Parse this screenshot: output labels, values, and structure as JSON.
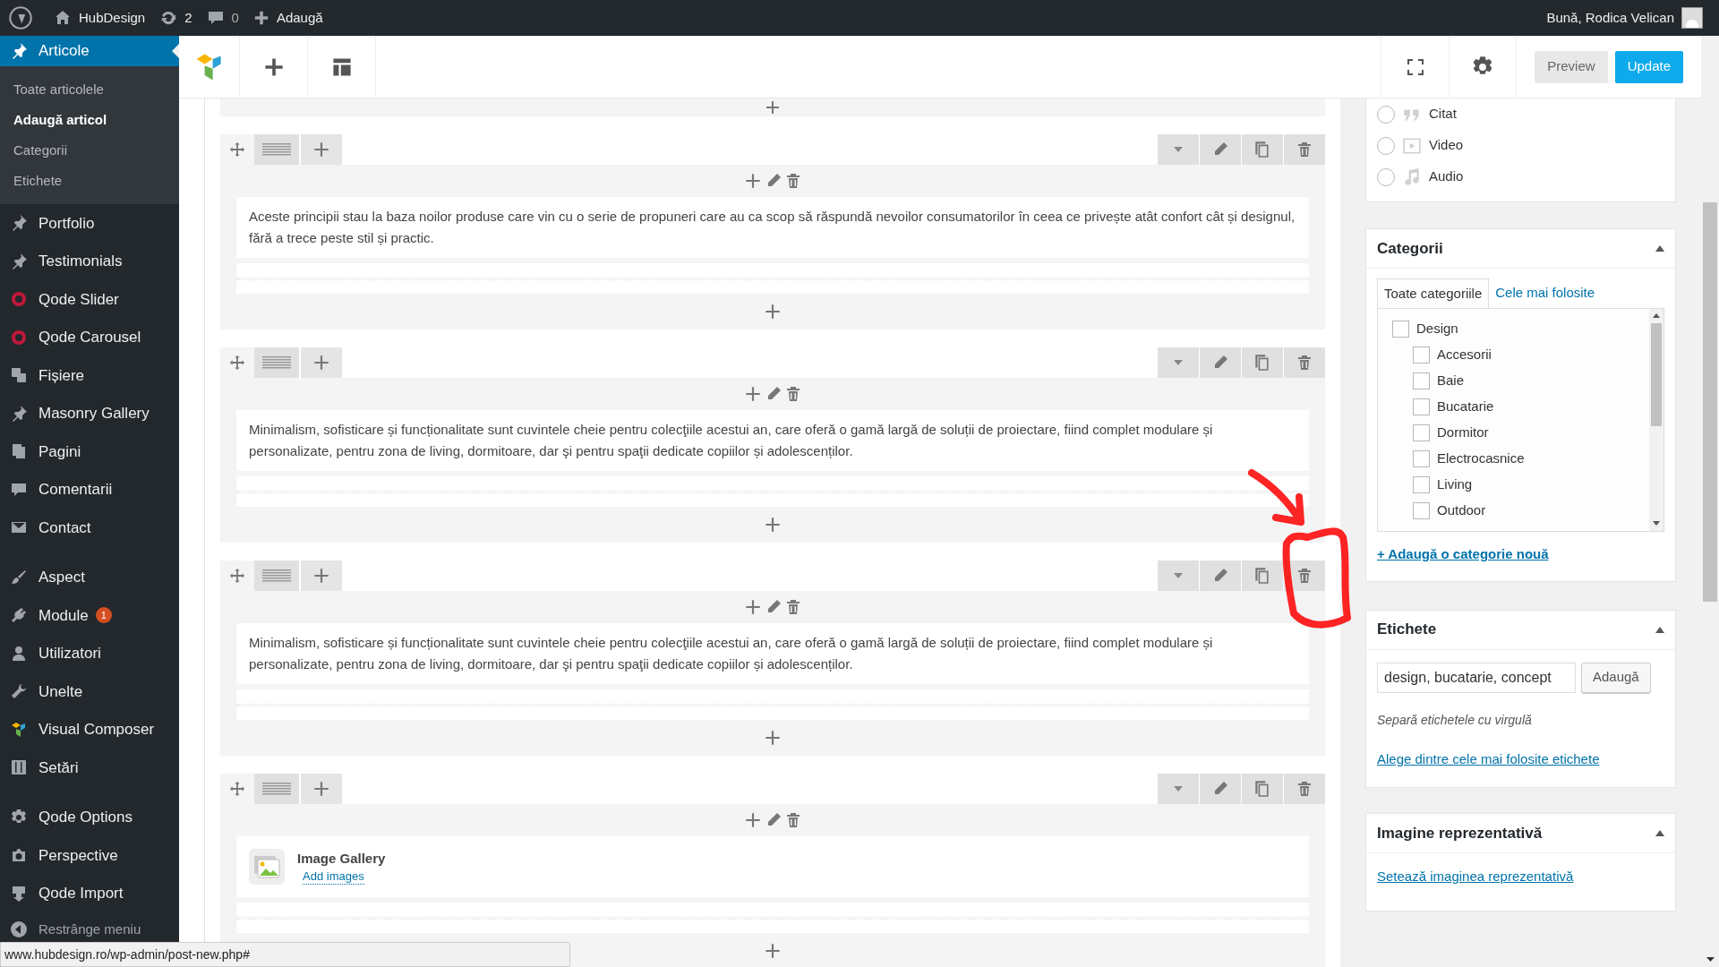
{
  "admin_bar": {
    "site": "HubDesign",
    "updates": "2",
    "comments": "0",
    "new": "Adaugă",
    "greeting": "Bună, Rodica Velican"
  },
  "sidebar": {
    "groups": [
      {
        "items": [
          {
            "label": "Articole",
            "selected": true,
            "submenu": [
              {
                "label": "Toate articolele",
                "selected": false
              },
              {
                "label": "Adaugă articol",
                "selected": true
              },
              {
                "label": "Categorii",
                "selected": false
              },
              {
                "label": "Etichete",
                "selected": false
              }
            ]
          },
          {
            "label": "Portfolio",
            "selected": false
          },
          {
            "label": "Testimonials",
            "selected": false
          },
          {
            "label": "Qode Slider",
            "selected": false
          },
          {
            "label": "Qode Carousel",
            "selected": false
          },
          {
            "label": "Fișiere",
            "selected": false
          },
          {
            "label": "Masonry Gallery",
            "selected": false
          },
          {
            "label": "Pagini",
            "selected": false
          },
          {
            "label": "Comentarii",
            "selected": false
          },
          {
            "label": "Contact",
            "selected": false
          }
        ]
      },
      {
        "items": [
          {
            "label": "Aspect",
            "selected": false
          },
          {
            "label": "Module",
            "selected": false,
            "badge": "1"
          },
          {
            "label": "Utilizatori",
            "selected": false
          },
          {
            "label": "Unelte",
            "selected": false
          },
          {
            "label": "Visual Composer",
            "selected": false
          },
          {
            "label": "Setări",
            "selected": false
          }
        ]
      },
      {
        "items": [
          {
            "label": "Qode Options",
            "selected": false
          },
          {
            "label": "Perspective",
            "selected": false
          },
          {
            "label": "Qode Import",
            "selected": false
          }
        ]
      }
    ],
    "collapse": "Restrânge meniu"
  },
  "toolbar": {
    "preview": "Preview",
    "update": "Update"
  },
  "rows": [
    {
      "kind": "text",
      "text": "Aceste principii stau la baza noilor produse care vin cu o serie de propuneri care au ca scop să răspundă nevoilor consumatorilor în ceea ce privește atât confort cât și designul, fără a trece peste stil și practic."
    },
    {
      "kind": "text",
      "text": "Minimalism, sofisticare și funcționalitate sunt cuvintele cheie pentru colecţiile acestui an, care oferă o gamă largă de soluții de proiectare, fiind complet modulare și personalizate, pentru zona de living, dormitoare, dar şi pentru spaţii dedicate copiilor și adolescenților."
    },
    {
      "kind": "text",
      "text": "Minimalism, sofisticare și funcționalitate sunt cuvintele cheie pentru colecţiile acestui an, care oferă o gamă largă de soluții de proiectare, fiind complet modulare și personalizate, pentru zona de living, dormitoare, dar şi pentru spaţii dedicate copiilor și adolescenților."
    },
    {
      "kind": "gallery",
      "title": "Image Gallery",
      "link": "Add images"
    }
  ],
  "format": {
    "options": [
      {
        "label": "Citat",
        "selected": false
      },
      {
        "label": "Video",
        "selected": false
      },
      {
        "label": "Audio",
        "selected": false
      }
    ]
  },
  "categories": {
    "title": "Categorii",
    "tabs": [
      {
        "label": "Toate categoriile",
        "selected": true
      },
      {
        "label": "Cele mai folosite",
        "selected": false
      }
    ],
    "items": [
      {
        "label": "Design",
        "checked": false,
        "children": [
          {
            "label": "Accesorii",
            "checked": false
          },
          {
            "label": "Baie",
            "checked": false
          },
          {
            "label": "Bucatarie",
            "checked": false
          },
          {
            "label": "Dormitor",
            "checked": false
          },
          {
            "label": "Electrocasnice",
            "checked": false
          },
          {
            "label": "Living",
            "checked": false
          },
          {
            "label": "Outdoor",
            "checked": false
          }
        ]
      }
    ],
    "add_link": "+ Adaugă o categorie nouă"
  },
  "tags": {
    "title": "Etichete",
    "value": "design, bucatarie, concept",
    "button": "Adaugă",
    "hint": "Separă etichetele cu virgulă",
    "link": "Alege dintre cele mai folosite etichete"
  },
  "featured_image": {
    "title": "Imagine reprezentativă",
    "link": "Setează imaginea reprezentativă"
  },
  "status_bar": "www.hubdesign.ro/wp-admin/post-new.php#"
}
